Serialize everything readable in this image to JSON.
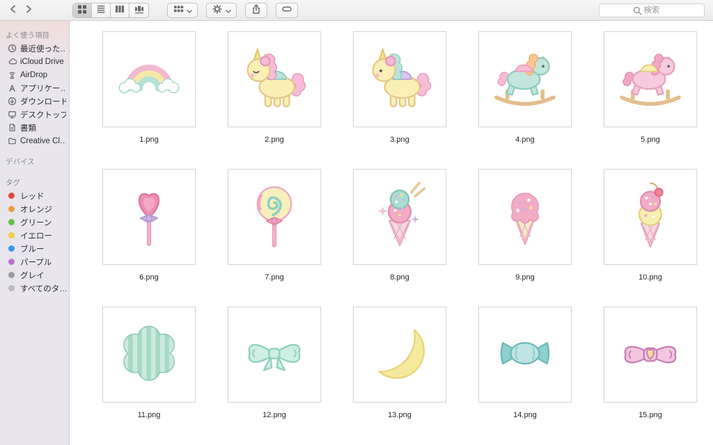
{
  "toolbar": {
    "search_placeholder": "検索",
    "views": [
      "icon",
      "list",
      "column",
      "coverflow"
    ],
    "selected_view": "icon"
  },
  "sidebar": {
    "sections": [
      {
        "title": "よく使う項目",
        "items": [
          {
            "label": "最近使った…",
            "icon": "recents-icon"
          },
          {
            "label": "iCloud Drive",
            "icon": "icloud-icon"
          },
          {
            "label": "AirDrop",
            "icon": "airdrop-icon"
          },
          {
            "label": "アプリケー…",
            "icon": "applications-icon"
          },
          {
            "label": "ダウンロード",
            "icon": "downloads-icon"
          },
          {
            "label": "デスクトップ",
            "icon": "desktop-icon"
          },
          {
            "label": "書類",
            "icon": "documents-icon"
          },
          {
            "label": "Creative Cl…",
            "icon": "folder-icon"
          }
        ]
      },
      {
        "title": "デバイス",
        "items": []
      },
      {
        "title": "タグ",
        "items": [
          {
            "label": "レッド",
            "dot": "#df4a3e"
          },
          {
            "label": "オレンジ",
            "dot": "#f09c38"
          },
          {
            "label": "グリーン",
            "dot": "#5fc344"
          },
          {
            "label": "イエロー",
            "dot": "#f7ce45"
          },
          {
            "label": "ブルー",
            "dot": "#3399f5"
          },
          {
            "label": "パープル",
            "dot": "#c36fd9"
          },
          {
            "label": "グレイ",
            "dot": "#9b9b9f"
          },
          {
            "label": "すべてのタ…",
            "dot": "#b9b9be"
          }
        ]
      }
    ]
  },
  "files": [
    {
      "name": "1.png",
      "icon": "rainbow"
    },
    {
      "name": "2.png",
      "icon": "unicorn-pink"
    },
    {
      "name": "3.png",
      "icon": "unicorn-teal"
    },
    {
      "name": "4.png",
      "icon": "rocking-horse-teal"
    },
    {
      "name": "5.png",
      "icon": "rocking-horse-pink"
    },
    {
      "name": "6.png",
      "icon": "heart-lollipop"
    },
    {
      "name": "7.png",
      "icon": "swirl-lollipop"
    },
    {
      "name": "8.png",
      "icon": "icecream-double"
    },
    {
      "name": "9.png",
      "icon": "icecream-pink"
    },
    {
      "name": "10.png",
      "icon": "icecream-cherry"
    },
    {
      "name": "11.png",
      "icon": "striped-flower"
    },
    {
      "name": "12.png",
      "icon": "bow-mint"
    },
    {
      "name": "13.png",
      "icon": "moon"
    },
    {
      "name": "14.png",
      "icon": "candy"
    },
    {
      "name": "15.png",
      "icon": "bow-pink"
    }
  ]
}
